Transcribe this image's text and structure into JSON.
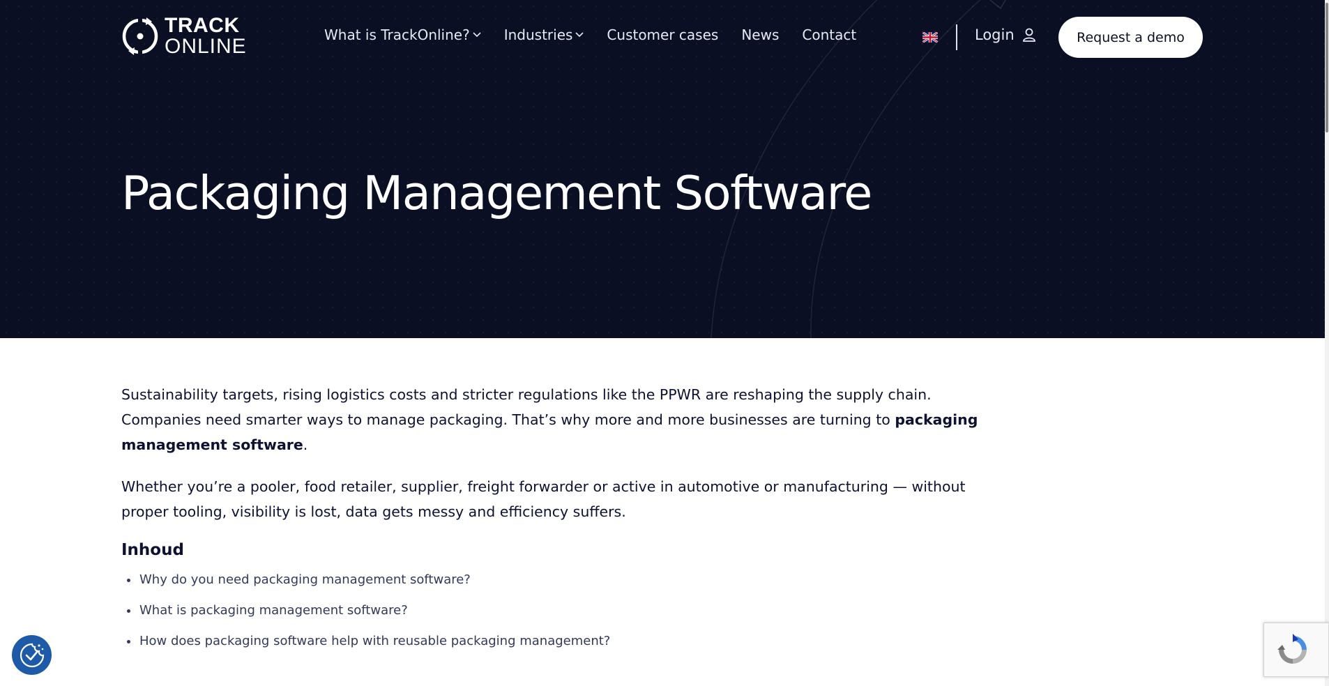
{
  "brand": {
    "logo_line1": "TRACK",
    "logo_line2": "ONLINE"
  },
  "nav": {
    "items": [
      {
        "label": "What is TrackOnline?",
        "dropdown": true
      },
      {
        "label": "Industries",
        "dropdown": true
      },
      {
        "label": "Customer cases",
        "dropdown": false
      },
      {
        "label": "News",
        "dropdown": false
      },
      {
        "label": "Contact",
        "dropdown": false
      }
    ],
    "language_icon": "uk-flag-icon",
    "login_label": "Login",
    "demo_label": "Request a demo"
  },
  "hero": {
    "title": "Packaging Management Software"
  },
  "main": {
    "intro_text": "Sustainability targets, rising logistics costs and stricter regulations like the PPWR are reshaping the supply chain. Companies need smarter ways to manage packaging. That’s why more and more businesses are turning to ",
    "intro_bold": "packaging management software",
    "intro_end": ".",
    "paragraph2": "Whether you’re a pooler, food retailer, supplier, freight forwarder or active in automotive or manufacturing — without proper tooling, visibility is lost, data gets messy and efficiency suffers.",
    "toc_title": "Inhoud",
    "toc_items": [
      "Why do you need packaging management software?",
      "What is packaging management software?",
      "How does packaging software help with reusable packaging management?"
    ]
  },
  "widgets": {
    "cookie_icon": "cookie-consent-icon",
    "recaptcha_icon": "recaptcha-icon"
  },
  "colors": {
    "hero_bg": "#0b0f24",
    "text_primary": "#0d1233",
    "cookie_button": "#1d5aa8"
  }
}
